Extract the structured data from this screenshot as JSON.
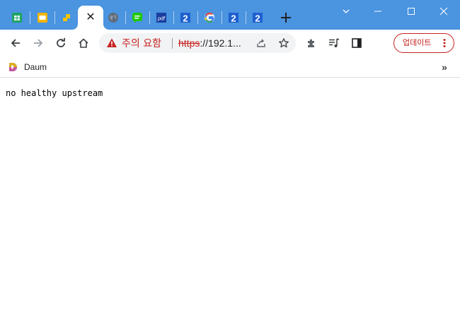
{
  "tabs": [
    {
      "icon": "sheets-icon"
    },
    {
      "icon": "slides-icon"
    },
    {
      "icon": "yellow-squares-icon"
    },
    {
      "icon": "close-icon",
      "active": true
    },
    {
      "icon": "globe-icon"
    },
    {
      "icon": "chat-icon"
    },
    {
      "icon": "pdf-icon",
      "label": "pdf"
    },
    {
      "icon": "number-two-icon",
      "label": "2"
    },
    {
      "icon": "google-icon",
      "label": "G"
    },
    {
      "icon": "number-two-icon",
      "label": "2"
    },
    {
      "icon": "number-two-icon",
      "label": "2"
    }
  ],
  "colors": {
    "tabstrip": "#4a94e0",
    "warning": "#c5221f"
  },
  "address_bar": {
    "security_warning": "주의 요함",
    "url_scheme": "https",
    "url_rest": "://192.1..."
  },
  "toolbar": {
    "update_label": "업데이트"
  },
  "bookmarks": [
    {
      "label": "Daum",
      "icon": "daum-icon"
    }
  ],
  "page": {
    "body_text": "no healthy upstream"
  }
}
